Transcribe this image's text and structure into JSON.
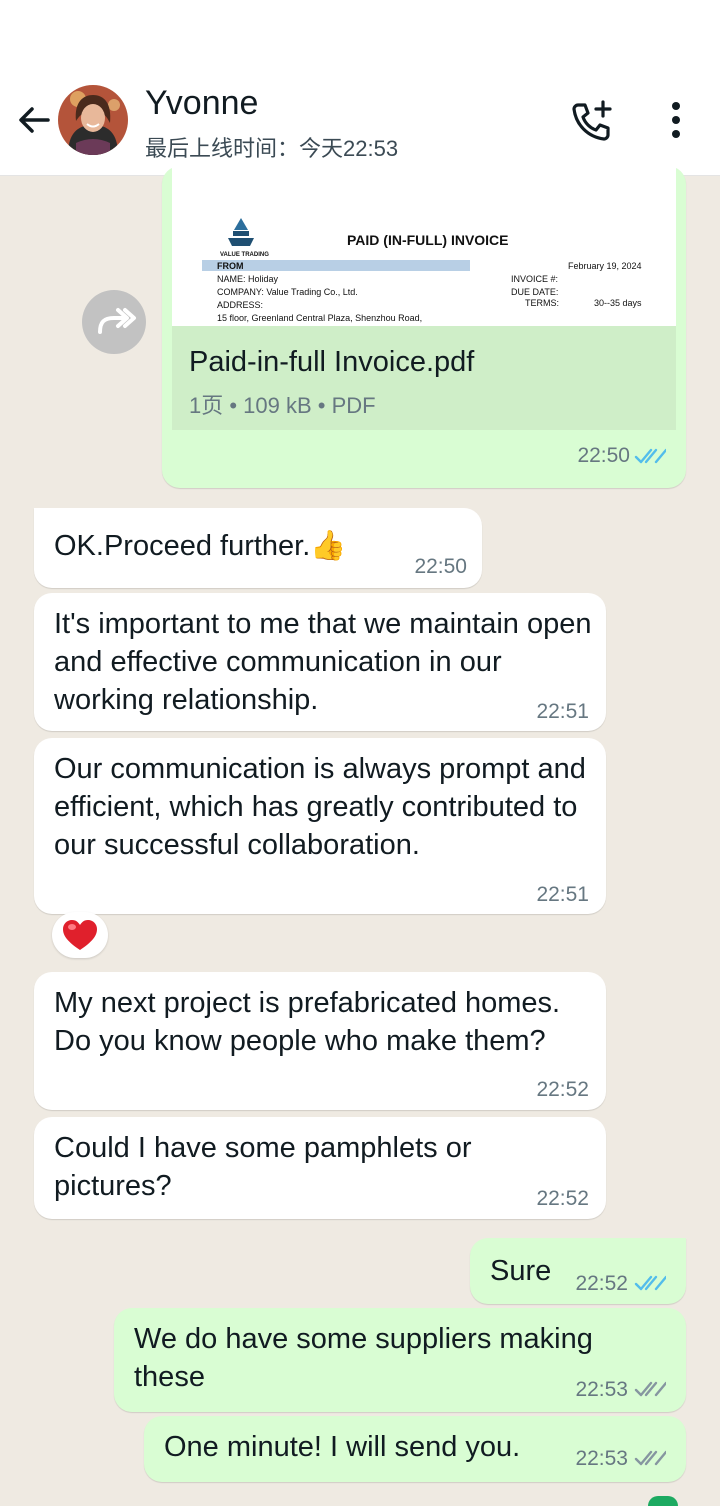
{
  "header": {
    "contact_name": "Yvonne",
    "last_seen": "最后上线时间：今天22:53"
  },
  "document": {
    "file_name": "Paid-in-full Invoice.pdf",
    "meta": "1页 • 109 kB • PDF",
    "time": "22:50",
    "status": "read",
    "preview": {
      "logo_text": "VALUE TRADING",
      "title": "PAID (IN-FULL) INVOICE",
      "from_label": "FROM",
      "date": "February 19, 2024",
      "name_line": "NAME: Holiday",
      "company_line": "COMPANY: Value Trading Co., Ltd.",
      "address_label": "ADDRESS:",
      "address_line": "15 floor, Greenland Central  Plaza, Shenzhou Road,",
      "invoice_label": "INVOICE #:",
      "due_label": "DUE DATE:",
      "terms_label": "TERMS:",
      "terms_value": "30--35 days"
    }
  },
  "messages": [
    {
      "dir": "in",
      "text": "OK.Proceed further.👍",
      "time": "22:50"
    },
    {
      "dir": "in",
      "text": "It's important to me that we maintain open and effective communication in our working relationship.",
      "time": "22:51"
    },
    {
      "dir": "in",
      "text": "Our communication is always prompt and efficient, which has greatly contributed to our successful collaboration.",
      "time": "22:51",
      "reaction": "❤️"
    },
    {
      "dir": "in",
      "text": "My next project is prefabricated homes. Do you know people who make them?",
      "time": "22:52"
    },
    {
      "dir": "in",
      "text": "Could I have some pamphlets or pictures?",
      "time": "22:52"
    },
    {
      "dir": "out",
      "text": "Sure",
      "time": "22:52",
      "status": "read"
    },
    {
      "dir": "out",
      "text": "We do have some suppliers making these",
      "time": "22:53",
      "status": "delivered"
    },
    {
      "dir": "out",
      "text": "One minute! I will send you.",
      "time": "22:53",
      "status": "delivered"
    }
  ],
  "colors": {
    "chat_bg": "#efeae2",
    "incoming": "#ffffff",
    "outgoing": "#d9fdd3",
    "read_tick": "#53bdeb",
    "sent_tick": "#8696a0"
  }
}
